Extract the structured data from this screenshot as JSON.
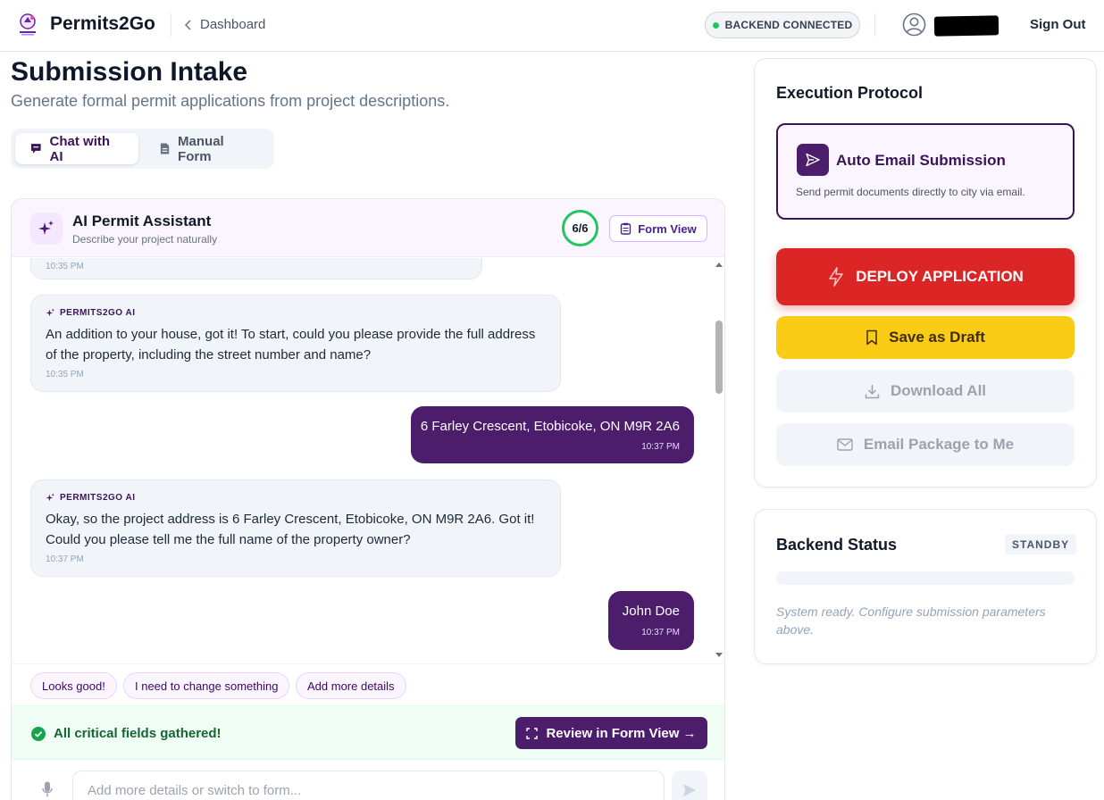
{
  "header": {
    "brand": "Permits2Go",
    "back_link": "Dashboard",
    "connection_status": "BACKEND CONNECTED",
    "sign_out": "Sign Out"
  },
  "page": {
    "title": "Submission Intake",
    "subtitle": "Generate formal permit applications from project descriptions."
  },
  "mode_tabs": [
    {
      "label": "Chat with AI",
      "active": true,
      "icon": "chat-icon"
    },
    {
      "label": "Manual Form",
      "active": false,
      "icon": "document-icon"
    }
  ],
  "assistant": {
    "title": "AI Permit Assistant",
    "subtitle": "Describe your project naturally",
    "progress": "6/6",
    "form_view_label": "Form View"
  },
  "messages": [
    {
      "role": "user",
      "text": "",
      "time": "10:35 PM"
    },
    {
      "role": "ai",
      "from": "PERMITS2GO AI",
      "text": "An addition to your house, got it! To start, could you please provide the full address of the property, including the street number and name?",
      "time": "10:35 PM"
    },
    {
      "role": "user",
      "text": "6 Farley Crescent, Etobicoke, ON M9R 2A6",
      "time": "10:37 PM"
    },
    {
      "role": "ai",
      "from": "PERMITS2GO AI",
      "text": "Okay, so the project address is 6 Farley Crescent, Etobicoke, ON M9R 2A6. Got it! Could you please tell me the full name of the property owner?",
      "time": "10:37 PM"
    },
    {
      "role": "user",
      "text": "John Doe",
      "time": "10:37 PM"
    }
  ],
  "quick_replies": [
    "Looks good!",
    "I need to change something",
    "Add more details"
  ],
  "completion": {
    "message": "All critical fields gathered!",
    "review_button": "Review in Form View →"
  },
  "composer": {
    "placeholder": "Add more details or switch to form..."
  },
  "execution": {
    "title": "Execution Protocol",
    "protocol_title": "Auto Email Submission",
    "protocol_desc": "Send permit documents directly to city via email.",
    "deploy": "DEPLOY APPLICATION",
    "save_draft": "Save as Draft",
    "download": "Download All",
    "email_package": "Email Package to Me"
  },
  "backend": {
    "title": "Backend Status",
    "badge": "STANDBY",
    "message": "System ready. Configure submission parameters above."
  },
  "colors": {
    "brand_purple": "#4c1d6b",
    "deploy_red": "#dc2626",
    "draft_yellow": "#facc15",
    "success_green": "#22c55e"
  }
}
